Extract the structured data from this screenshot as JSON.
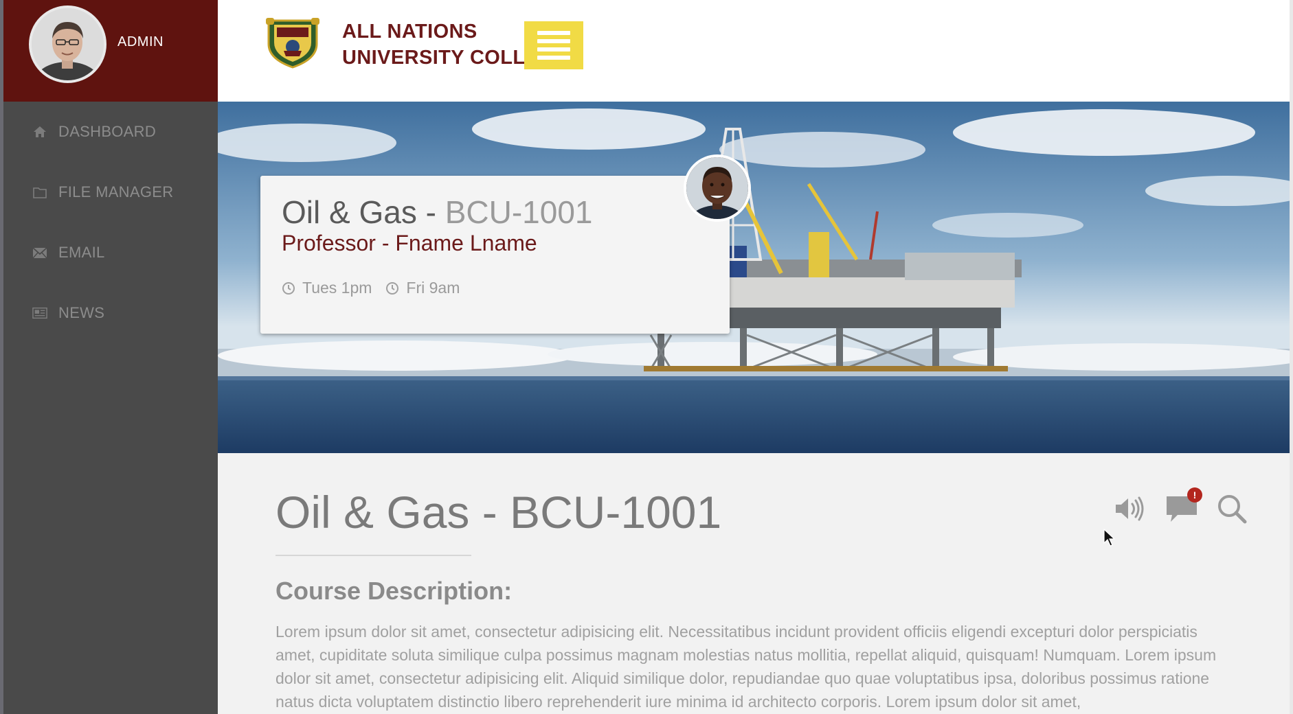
{
  "admin": {
    "name": "ADMIN"
  },
  "college": {
    "name_line1": "ALL NATIONS",
    "name_line2": "UNIVERSITY COLLEGE"
  },
  "sidebar": {
    "items": [
      {
        "label": "DASHBOARD",
        "icon": "home-icon"
      },
      {
        "label": "FILE MANAGER",
        "icon": "folder-icon"
      },
      {
        "label": "EMAIL",
        "icon": "envelope-icon"
      },
      {
        "label": "NEWS",
        "icon": "newspaper-icon"
      }
    ]
  },
  "hero_card": {
    "course_name": "Oil & Gas - ",
    "course_code": "BCU-1001",
    "professor": "Professor - Fname Lname",
    "times": [
      "Tues 1pm",
      "Fri 9am"
    ]
  },
  "main": {
    "title": "Oil & Gas - BCU-1001",
    "section_heading": "Course Description:",
    "description": "Lorem ipsum dolor sit amet, consectetur adipisicing elit. Necessitatibus incidunt provident officiis eligendi excepturi dolor perspiciatis amet, cupiditate soluta similique culpa possimus magnam molestias natus mollitia, repellat aliquid, quisquam! Numquam. Lorem ipsum dolor sit amet, consectetur adipisicing elit. Aliquid similique dolor, repudiandae quo quae voluptatibus ipsa, doloribus possimus ratione natus dicta voluptatem distinctio libero reprehenderit iure minima id architecto corporis. Lorem ipsum dolor sit amet,",
    "notification_badge": "!"
  },
  "colors": {
    "brand_maroon": "#5f130f",
    "accent_yellow": "#f1db45",
    "sidebar_bg": "#4a4a4a",
    "badge_red": "#b3261e"
  }
}
